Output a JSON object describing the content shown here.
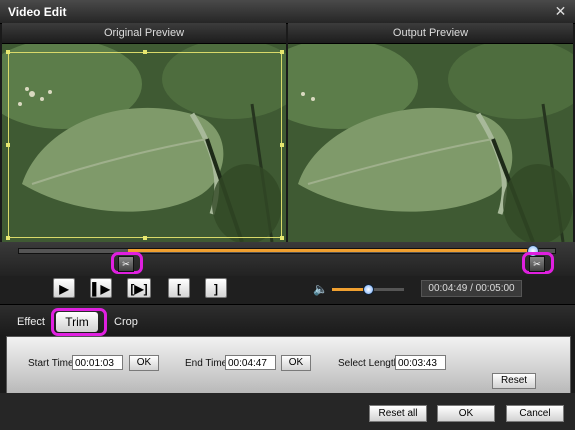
{
  "window": {
    "title": "Video Edit",
    "close_icon": "close-icon"
  },
  "preview": {
    "original_label": "Original Preview",
    "output_label": "Output Preview"
  },
  "timeline": {
    "start_marker_icon": "trim-start-marker-icon",
    "end_marker_icon": "trim-end-marker-icon"
  },
  "controls": {
    "play_icon": "play-icon",
    "step_icon": "step-forward-icon",
    "frame_icon": "next-frame-icon",
    "set_start_glyph": "[",
    "set_end_glyph": "]",
    "volume_icon": "speaker-icon",
    "volume_level": 0.45,
    "time_display": "00:04:49 / 00:05:00"
  },
  "tabs": [
    {
      "label": "Effect"
    },
    {
      "label": "Trim",
      "active": true
    },
    {
      "label": "Crop"
    }
  ],
  "trim": {
    "start_label": "Start Time",
    "start_value": "00:01:03",
    "end_label": "End Time",
    "end_value": "00:04:47",
    "length_label": "Select Length",
    "length_value": "00:03:43",
    "ok_label": "OK",
    "reset_label": "Reset"
  },
  "footer": {
    "reset_all_label": "Reset all",
    "ok_label": "OK",
    "cancel_label": "Cancel"
  },
  "colors": {
    "accent": "#f0a030",
    "highlight": "#e020e0"
  }
}
